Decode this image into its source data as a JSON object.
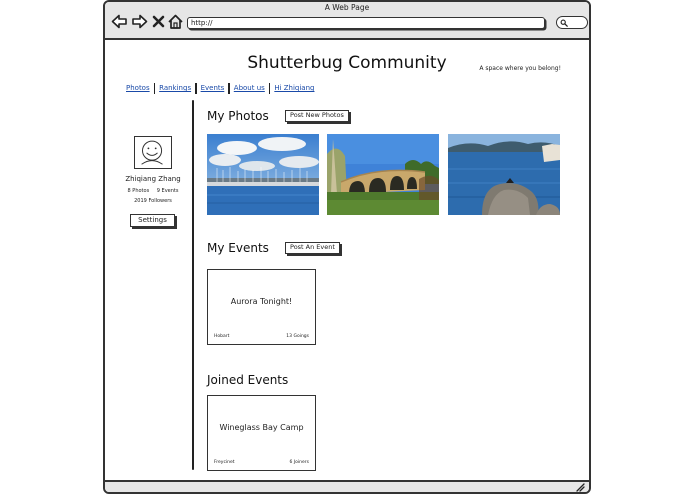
{
  "browser": {
    "window_title": "A Web Page",
    "url": "http://"
  },
  "site": {
    "title": "Shutterbug Community",
    "tagline": "A space where you belong!"
  },
  "nav": {
    "links": [
      "Photos",
      "Rankings",
      "Events",
      "About us",
      "Hi Zhiqiang"
    ]
  },
  "profile": {
    "name": "Zhiqiang Zhang",
    "photos": "8 Photos",
    "events": "9 Events",
    "followers": "2019 Followers",
    "settings_label": "Settings"
  },
  "my_photos": {
    "title": "My Photos",
    "button": "Post New Photos",
    "photos": [
      "harbor-marina-photo",
      "stone-bridge-photo",
      "coastal-rock-photo"
    ]
  },
  "my_events": {
    "title": "My Events",
    "button": "Post An Event",
    "events": [
      {
        "name": "Aurora Tonight!",
        "location": "Hobart",
        "count": "13 Goings"
      }
    ]
  },
  "joined_events": {
    "title": "Joined Events",
    "events": [
      {
        "name": "Wineglass Bay Camp",
        "location": "Freycinet",
        "count": "6 Joiners"
      }
    ]
  },
  "colors": {
    "link": "#1a4aa8",
    "chrome": "#e6e6e6",
    "outline": "#333333"
  }
}
